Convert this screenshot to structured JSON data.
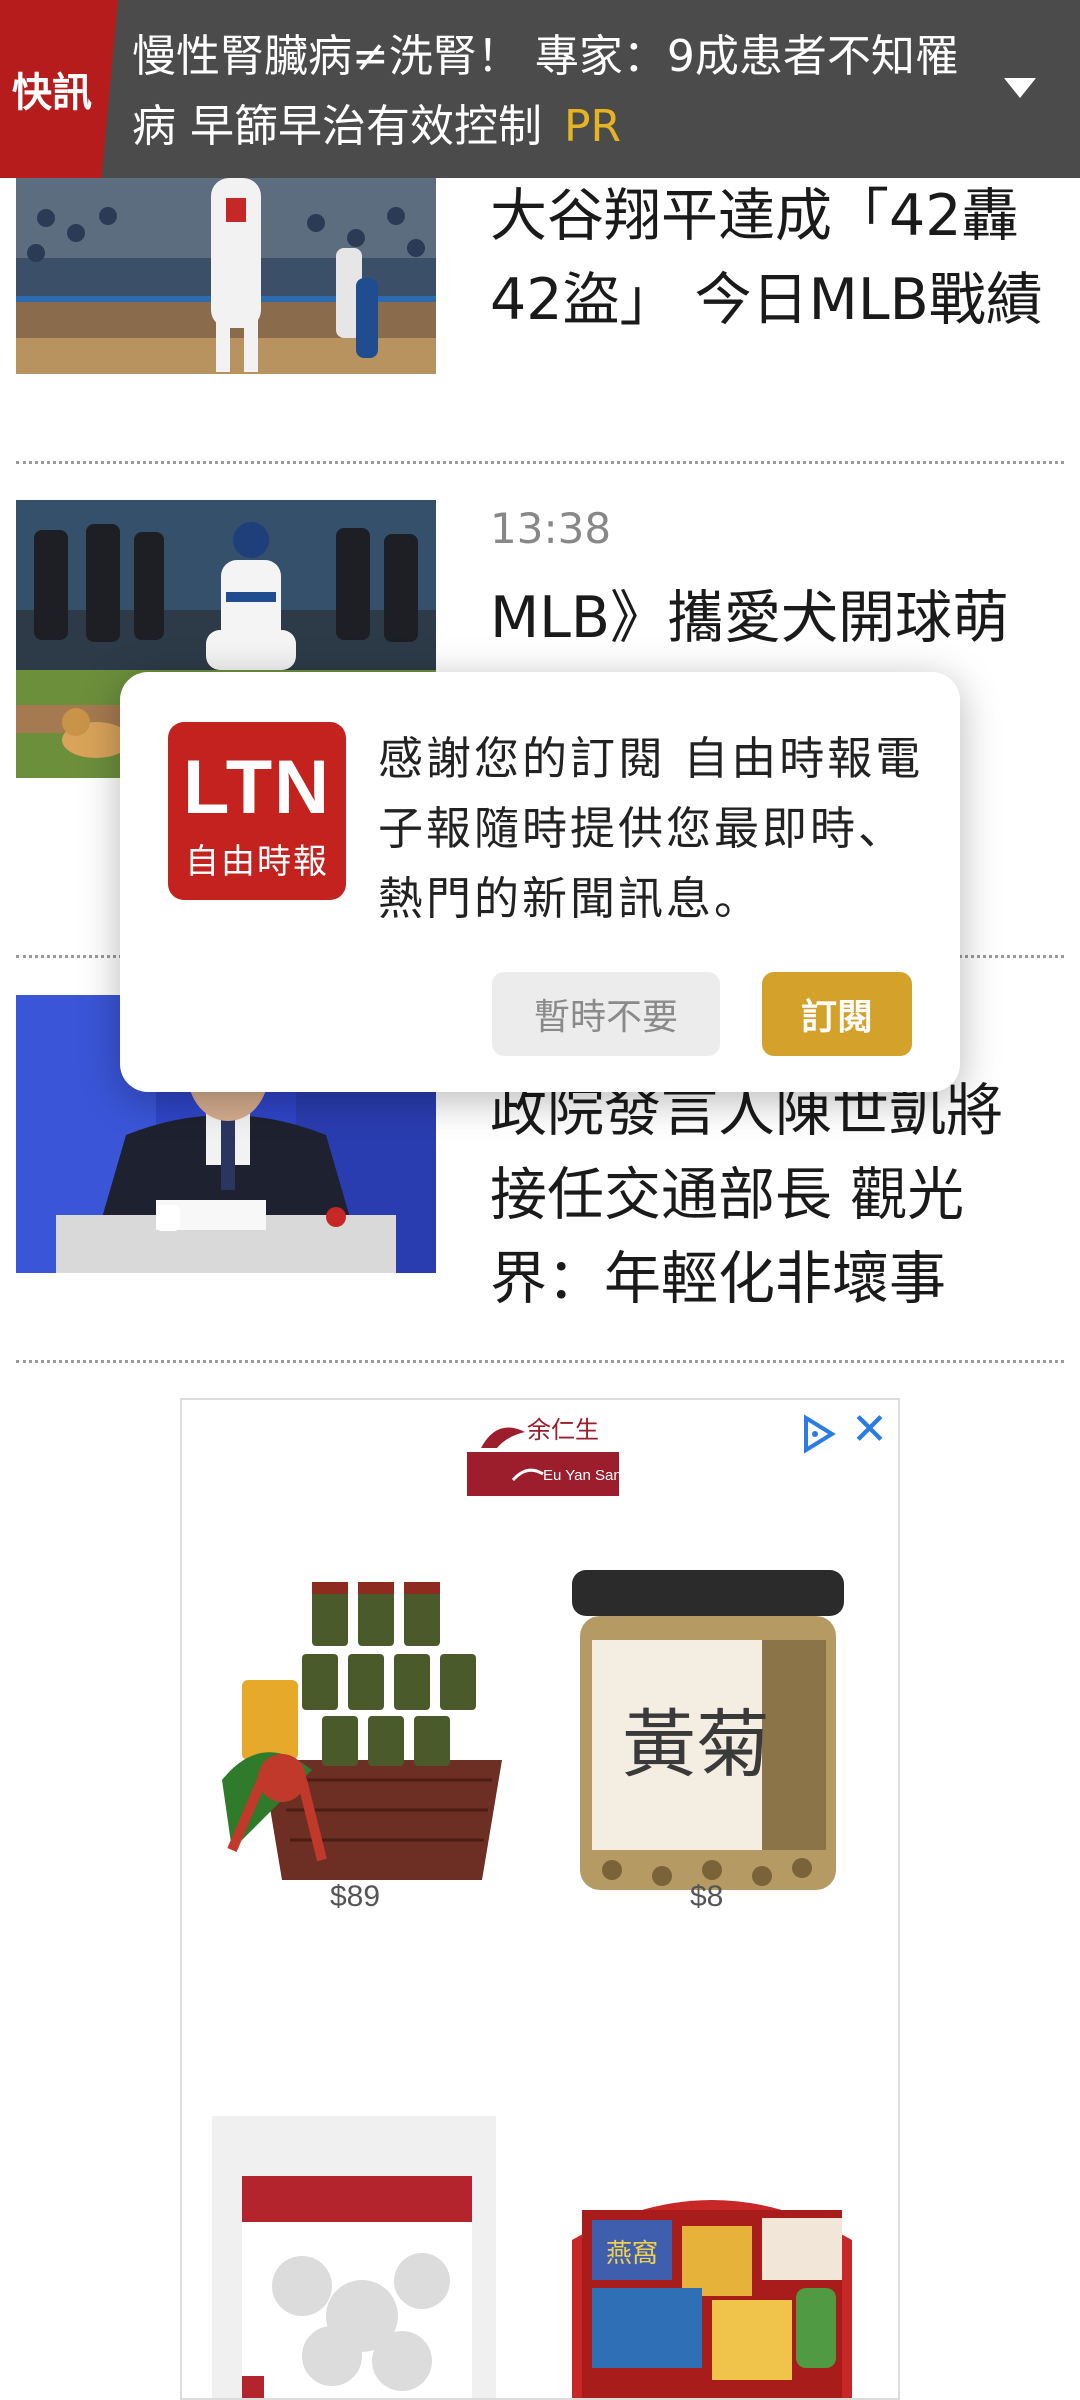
{
  "flash": {
    "tag": "快訊",
    "headline": "慢性腎臟病≠洗腎！ 專家：9成患者不知罹病 早篩早治有效控制",
    "pr": "PR",
    "expand_icon": "chevron-down-icon"
  },
  "news": [
    {
      "time": "",
      "title": "大谷翔平達成「42轟42盜」 今日MLB戰績",
      "thumb": "baseball-player-photo"
    },
    {
      "time": "13:38",
      "title": "MLB》攜愛犬開球萌翻…大谷翔平練",
      "thumb": "dog-first-pitch-photo"
    },
    {
      "time": "",
      "title": "政院發言人陳世凱將接任交通部長 觀光界：年輕化非壞事",
      "thumb": "press-conference-photo"
    }
  ],
  "ad": {
    "brand": "Eu Yan Sang",
    "brand_cn": "余仁生",
    "products": [
      {
        "price": "$89",
        "image": "gift-basket"
      },
      {
        "price": "$8",
        "image": "chrysanthemum-jar",
        "label": "黃菊"
      },
      {
        "price": "",
        "image": "bird-nest-bag"
      },
      {
        "price": "",
        "image": "gift-box",
        "label": "燕窩"
      }
    ]
  },
  "modal": {
    "logo_text": "LTN",
    "logo_sub": "自由時報",
    "message": "感謝您的訂閱 自由時報電子報隨時提供您最即時、熱門的新聞訊息。",
    "later_label": "暫時不要",
    "subscribe_label": "訂閱"
  }
}
